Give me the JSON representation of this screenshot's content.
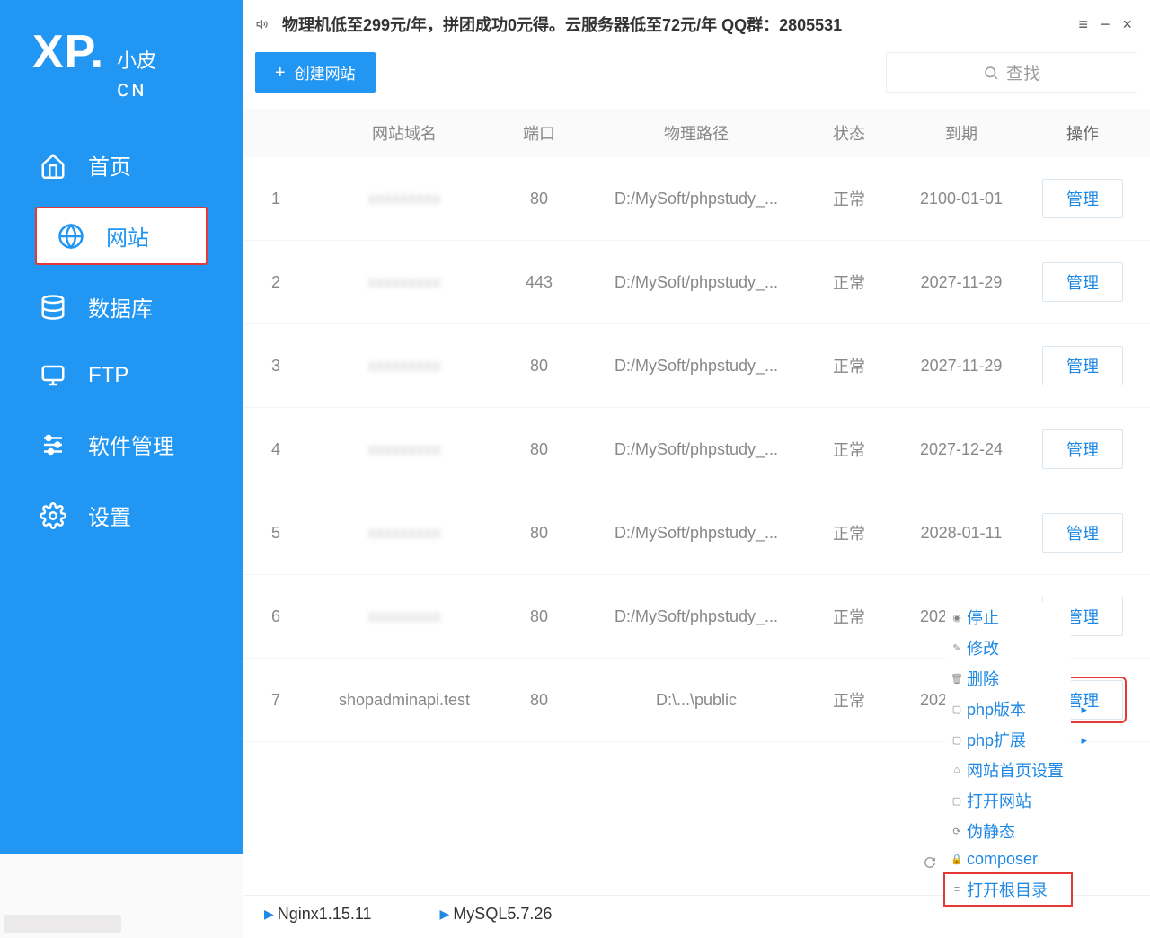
{
  "logo": {
    "xp": "XP.",
    "xiaopi": "小皮",
    "cn": "ᴄɴ"
  },
  "sidebar": {
    "items": [
      {
        "label": "首页",
        "icon": "home"
      },
      {
        "label": "网站",
        "icon": "globe"
      },
      {
        "label": "数据库",
        "icon": "database"
      },
      {
        "label": "FTP",
        "icon": "monitor"
      },
      {
        "label": "软件管理",
        "icon": "sliders"
      },
      {
        "label": "设置",
        "icon": "gear"
      }
    ]
  },
  "topbar": {
    "promo": "物理机低至299元/年，拼团成功0元得。云服务器低至72元/年  QQ群：2805531"
  },
  "toolbar": {
    "create_label": "创建网站",
    "search_placeholder": "查找"
  },
  "table": {
    "headers": {
      "domain": "网站域名",
      "port": "端口",
      "path": "物理路径",
      "status": "状态",
      "expire": "到期",
      "ops": "操作"
    },
    "manage_label": "管理",
    "rows": [
      {
        "idx": "1",
        "domain": "",
        "port": "80",
        "path": "D:/MySoft/phpstudy_...",
        "status": "正常",
        "expire": "2100-01-01",
        "blur": true
      },
      {
        "idx": "2",
        "domain": "",
        "port": "443",
        "path": "D:/MySoft/phpstudy_...",
        "status": "正常",
        "expire": "2027-11-29",
        "blur": true
      },
      {
        "idx": "3",
        "domain": "",
        "port": "80",
        "path": "D:/MySoft/phpstudy_...",
        "status": "正常",
        "expire": "2027-11-29",
        "blur": true
      },
      {
        "idx": "4",
        "domain": "",
        "port": "80",
        "path": "D:/MySoft/phpstudy_...",
        "status": "正常",
        "expire": "2027-12-24",
        "blur": true
      },
      {
        "idx": "5",
        "domain": "",
        "port": "80",
        "path": "D:/MySoft/phpstudy_...",
        "status": "正常",
        "expire": "2028-01-11",
        "blur": true
      },
      {
        "idx": "6",
        "domain": "",
        "port": "80",
        "path": "D:/MySoft/phpstudy_...",
        "status": "正常",
        "expire": "2028-02-08",
        "blur": true
      },
      {
        "idx": "7",
        "domain": "shopadminapi.test",
        "port": "80",
        "path": "D:\\...\\public",
        "status": "正常",
        "expire": "2028-03-17",
        "blur": false,
        "highlight": true
      }
    ]
  },
  "context_menu": {
    "items": [
      {
        "label": "停止",
        "icon": "stop"
      },
      {
        "label": "修改",
        "icon": "edit"
      },
      {
        "label": "删除",
        "icon": "trash"
      },
      {
        "label": "php版本",
        "icon": "php",
        "submenu": true
      },
      {
        "label": "php扩展",
        "icon": "ext",
        "submenu": true
      },
      {
        "label": "网站首页设置",
        "icon": "home-sm"
      },
      {
        "label": "打开网站",
        "icon": "open"
      },
      {
        "label": "伪静态",
        "icon": "static"
      },
      {
        "label": "composer",
        "icon": "lock"
      },
      {
        "label": "打开根目录",
        "icon": "folder",
        "framed": true
      }
    ]
  },
  "statusbar": {
    "nginx": "Nginx1.15.11",
    "mysql": "MySQL5.7.26"
  }
}
